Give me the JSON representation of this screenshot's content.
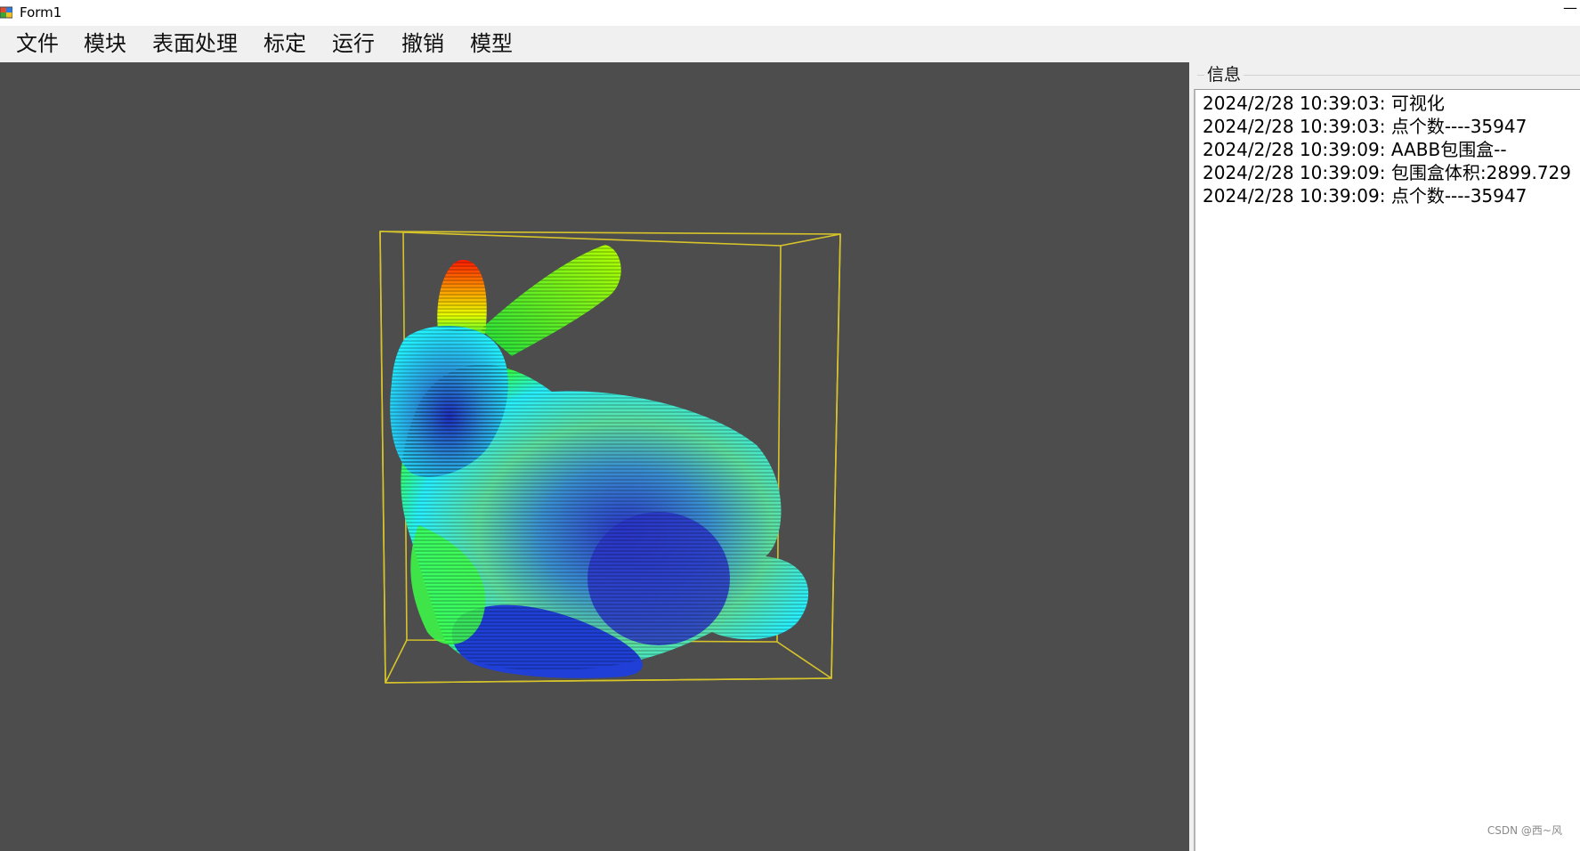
{
  "window": {
    "title": "Form1",
    "minimize_glyph": "—"
  },
  "menu": [
    {
      "label": "文件"
    },
    {
      "label": "模块"
    },
    {
      "label": "表面处理"
    },
    {
      "label": "标定"
    },
    {
      "label": "运行"
    },
    {
      "label": "撤销"
    },
    {
      "label": "模型"
    }
  ],
  "viewport": {
    "background_color": "#4d4d4d",
    "bounding_box_color": "#d6c42a",
    "model_colors": [
      "#1a2fd0",
      "#00e5ff",
      "#39ff5a",
      "#c8ff00",
      "#ff2a00"
    ]
  },
  "info_panel": {
    "title": "信息",
    "log": [
      "2024/2/28 10:39:03: 可视化",
      "2024/2/28 10:39:03: 点个数----35947",
      "2024/2/28 10:39:09: AABB包围盒--",
      "2024/2/28 10:39:09: 包围盒体积:2899.729",
      "2024/2/28 10:39:09: 点个数----35947"
    ]
  },
  "watermark": "CSDN @西~风"
}
